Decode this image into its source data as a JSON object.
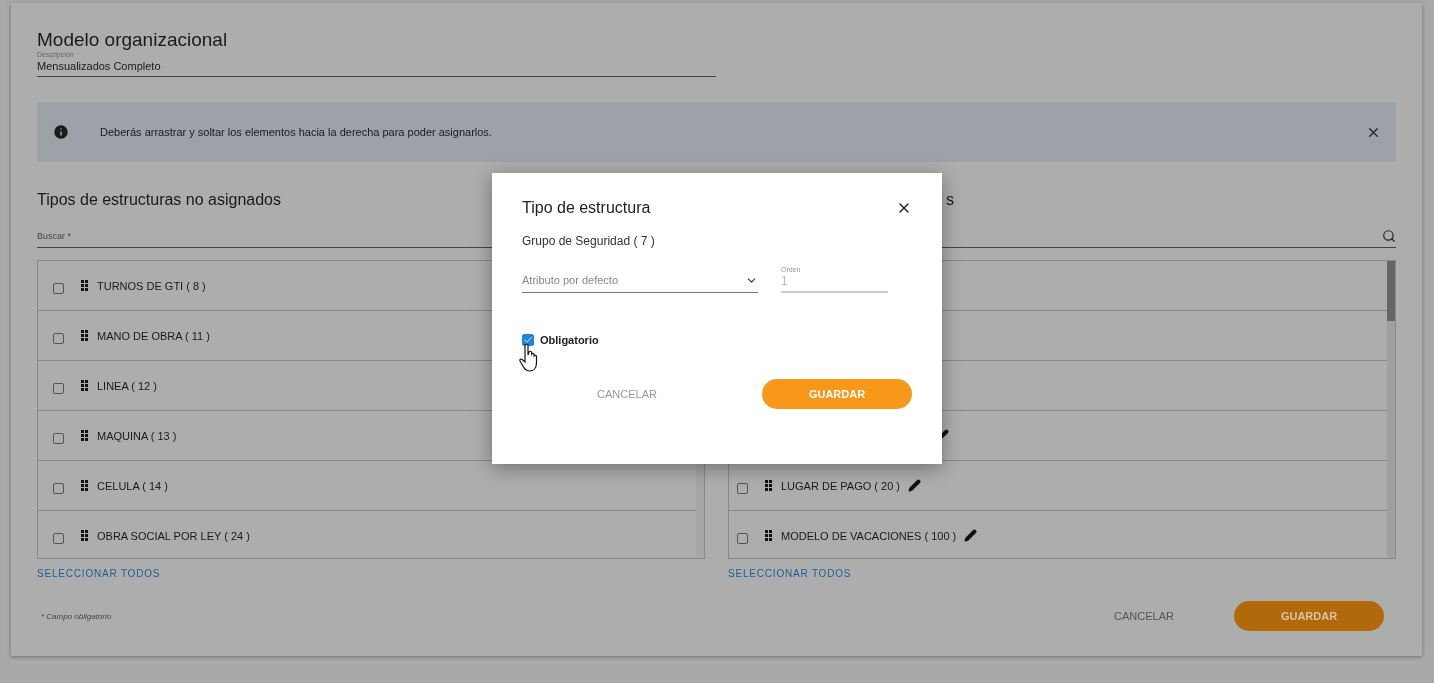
{
  "page": {
    "title": "Modelo organizacional",
    "description": {
      "label": "Descripción",
      "value": "Mensualizados Completo"
    }
  },
  "info_banner": {
    "text": "Deberás arrastrar y soltar los elementos hacia la derecha para poder asignarlos."
  },
  "unassigned": {
    "heading": "Tipos de estructuras no asignados",
    "search": {
      "label": "Buscar *"
    },
    "select_all": "SELECCIONAR TODOS",
    "items": [
      {
        "label": "TURNOS DE GTI ( 8 )",
        "checked": false
      },
      {
        "label": "MANO DE OBRA ( 11 )",
        "checked": false
      },
      {
        "label": "LINEA ( 12 )",
        "checked": false
      },
      {
        "label": "MAQUINA ( 13 )",
        "checked": false
      },
      {
        "label": "CELULA ( 14 )",
        "checked": false
      },
      {
        "label": "OBRA SOCIAL POR LEY ( 24 )",
        "checked": false
      }
    ]
  },
  "assigned": {
    "heading": "s",
    "select_all": "SELECCIONAR TODOS",
    "items": [
      {
        "kind": "covered"
      },
      {
        "kind": "covered"
      },
      {
        "kind": "covered"
      },
      {
        "kind": "covered",
        "editable": true
      },
      {
        "kind": "item",
        "label": "LUGAR DE PAGO ( 20 )",
        "checked": false,
        "editable": true
      },
      {
        "kind": "item",
        "label": "MODELO DE VACACIONES ( 100 )",
        "checked": false,
        "editable": true
      }
    ]
  },
  "footer": {
    "required_note": "* Campo obligatorio",
    "cancel": "CANCELAR",
    "save": "GUARDAR"
  },
  "modal": {
    "title": "Tipo de estructura",
    "subtitle": "Grupo de Seguridad ( 7 )",
    "select": {
      "placeholder": "Atributo por defecto"
    },
    "order": {
      "label": "Orden",
      "value": "1",
      "disabled": true
    },
    "required": {
      "label": "Obligatorio",
      "checked": true
    },
    "cancel": "CANCELAR",
    "save": "GUARDAR"
  }
}
